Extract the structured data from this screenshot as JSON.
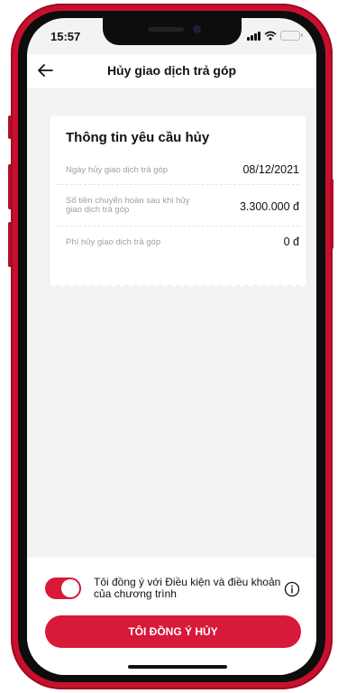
{
  "status_bar": {
    "time": "15:57"
  },
  "header": {
    "title": "Hủy giao dịch trả góp",
    "back_icon": "arrow-left-icon"
  },
  "card": {
    "title": "Thông tin yêu cầu hủy",
    "rows": [
      {
        "label": "Ngày hủy giao dịch trả góp",
        "value": "08/12/2021"
      },
      {
        "label_line1": "Số tiền chuyển hoàn sau khi hủy",
        "label_line2": "giao dịch trả góp",
        "value": "3.300.000 đ"
      },
      {
        "label": "Phí hủy giao dịch trả góp",
        "value": "0 đ"
      }
    ]
  },
  "agreement": {
    "toggle_on": true,
    "text_line1": "Tôi đồng ý với Điều kiện và điều khoản",
    "text_line2": "của chương trình",
    "info_icon": "info-circle-icon"
  },
  "primary_button": {
    "label": "TÔI ĐỒNG Ý HỦY"
  },
  "colors": {
    "accent": "#d7193a",
    "phone_frame": "#c8102e",
    "background": "#f3f3f3",
    "muted_text": "#a0a0a0"
  }
}
